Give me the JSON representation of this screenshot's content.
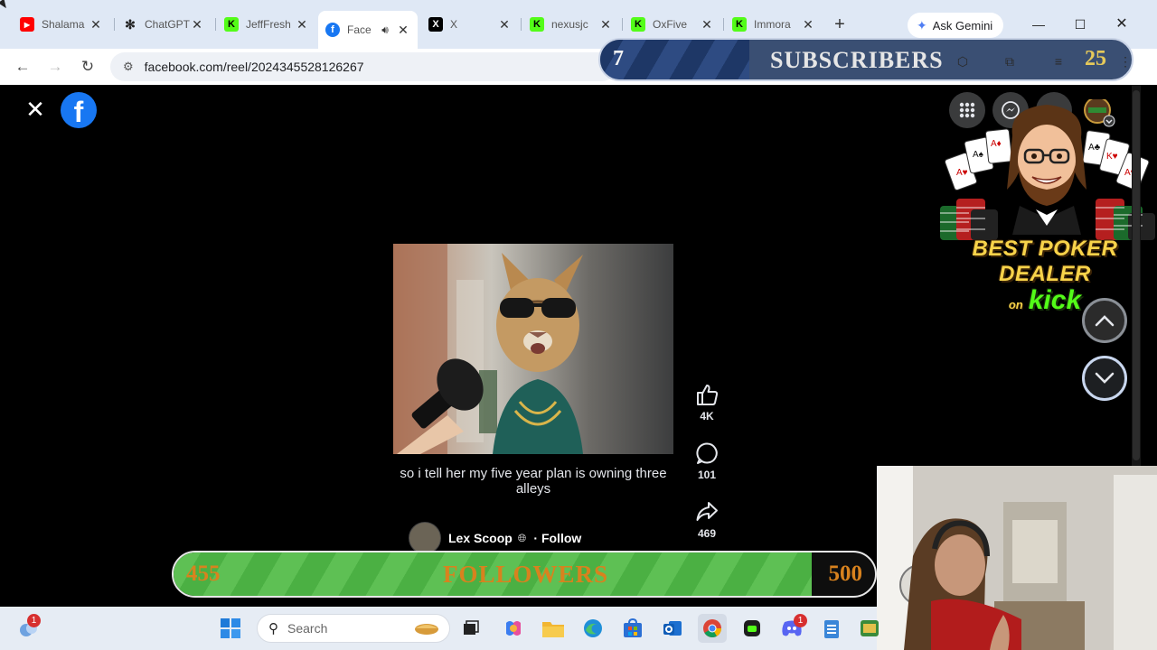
{
  "browser": {
    "tabs": [
      {
        "title": "Shalama",
        "icon": "youtube-icon",
        "color": "#ff0000"
      },
      {
        "title": "ChatGPT",
        "icon": "openai-icon",
        "color": "#222222"
      },
      {
        "title": "JeffFresh",
        "icon": "kick-icon",
        "color": "#53fc18"
      },
      {
        "title": "Face",
        "icon": "facebook-icon",
        "color": "#1877f2",
        "active": true
      },
      {
        "title": "X",
        "icon": "x-icon",
        "color": "#000000"
      },
      {
        "title": "nexusjc",
        "icon": "kick-icon",
        "color": "#53fc18"
      },
      {
        "title": "OxFive",
        "icon": "kick-icon",
        "color": "#53fc18"
      },
      {
        "title": "Immora",
        "icon": "kick-icon",
        "color": "#53fc18"
      }
    ],
    "new_tab_label": "+",
    "ask_gemini": "Ask Gemini",
    "url": "facebook.com/reel/2024345528126267"
  },
  "subs_overlay": {
    "current": "7",
    "label": "SUBSCRIBERS",
    "goal": "25",
    "progress": 0.28
  },
  "reel": {
    "caption": "so i tell her my five year plan is owning three alleys",
    "author": "Lex Scoop",
    "follow": "· Follow",
    "likes": "4K",
    "comments": "101",
    "shares": "469"
  },
  "poker_overlay": {
    "line1": "BEST POKER DEALER",
    "on": "on",
    "kick": "kick"
  },
  "followers_overlay": {
    "current": "455",
    "label": "FOLLOWERS",
    "goal": "500",
    "progress": 0.91
  },
  "taskbar": {
    "search_placeholder": "Search",
    "notification_badge": "1",
    "discord_badge": "1"
  },
  "colors": {
    "facebook_blue": "#1877f2",
    "kick_green": "#53fc18",
    "followers_text": "#d8821e"
  }
}
